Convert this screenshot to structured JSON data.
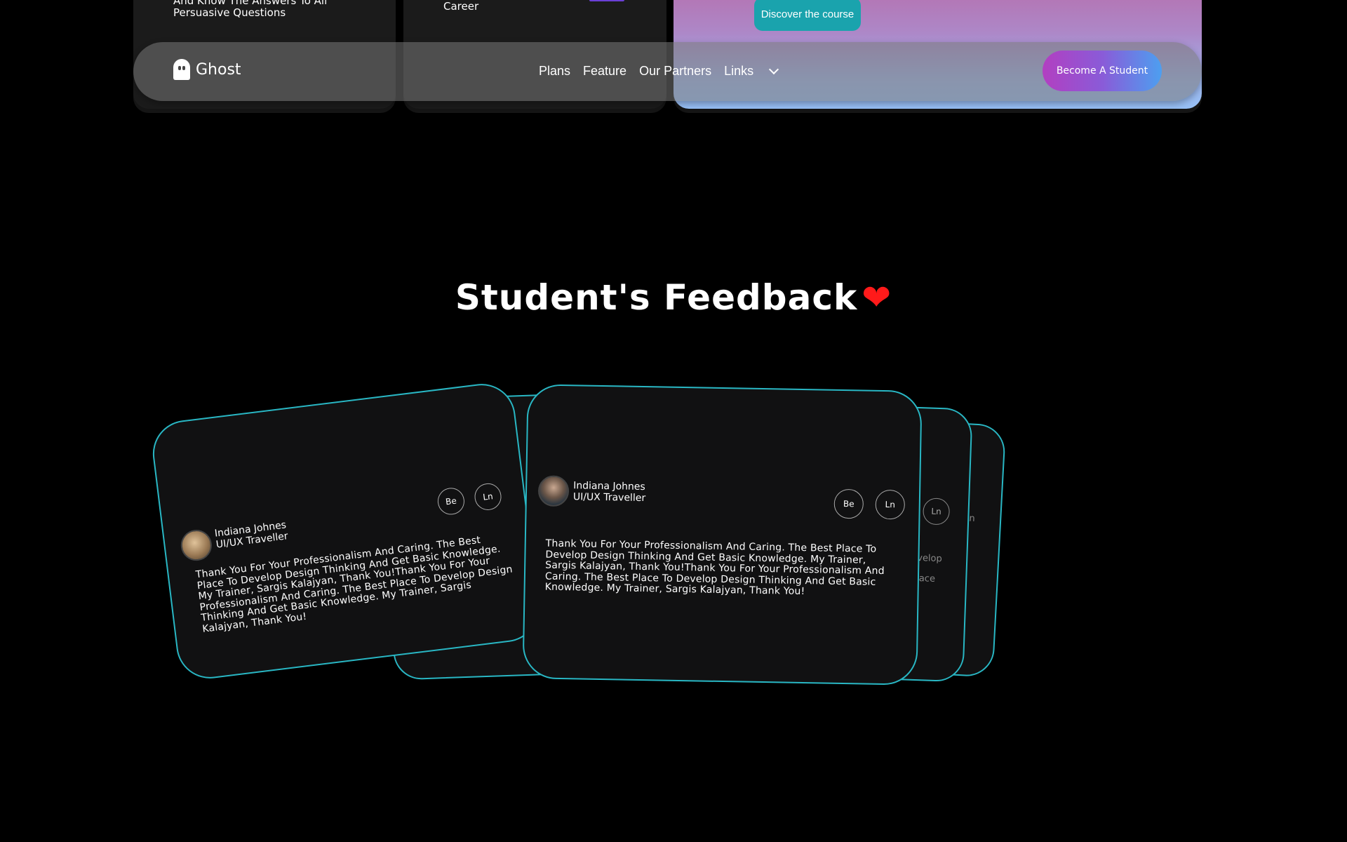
{
  "top_cards": {
    "card1_text": "And Know The Answers To All Persuasive Questions",
    "card2_text": "Career",
    "discover_label": "Discover the course"
  },
  "navbar": {
    "logo_text": "Ghost",
    "links": [
      "Plans",
      "Feature",
      "Our Partners",
      "Links"
    ],
    "cta_label": "Become A Student"
  },
  "section": {
    "title": "Student's Feedback"
  },
  "feedback": {
    "cards": [
      {
        "name": "Indiana Johnes",
        "role": "UI/UX Traveller",
        "social": [
          "Be",
          "Ln"
        ],
        "message": "Thank You For Your Professionalism And Caring. The Best Place To Develop Design Thinking And Get Basic Knowledge. My Trainer, Sargis Kalajyan, Thank You!Thank You For Your Professionalism And Caring. The Best Place To Develop Design Thinking And Get Basic Knowledge. My Trainer, Sargis Kalajyan, Thank You!"
      },
      {
        "name": "Indiana Johnes",
        "role": "UI/UX Traveller",
        "social": [
          "Be",
          "Ln"
        ],
        "message": "Thank You For Your Professionalism And Caring. The Best Place To Develop Design Thinking And Get Basic Knowledge. My Trainer, Sargis Kalajyan, Thank You!Thank You For Your Professionalism And Caring. The Best Place To Develop Design Thinking And Get Basic Knowledge. My Trainer, Sargis Kalajyan, Thank You!"
      }
    ],
    "back_fragments": {
      "ln": "Ln",
      "frag1": "velop",
      "frag2": "lace",
      "frag3": "p"
    }
  },
  "colors": {
    "accent_border": "#29b7c4",
    "heart": "#ff1a1a",
    "cta_gradient_start": "#b23fc1",
    "cta_gradient_end": "#4d9ff0",
    "discover_button": "#1aa3ad"
  }
}
